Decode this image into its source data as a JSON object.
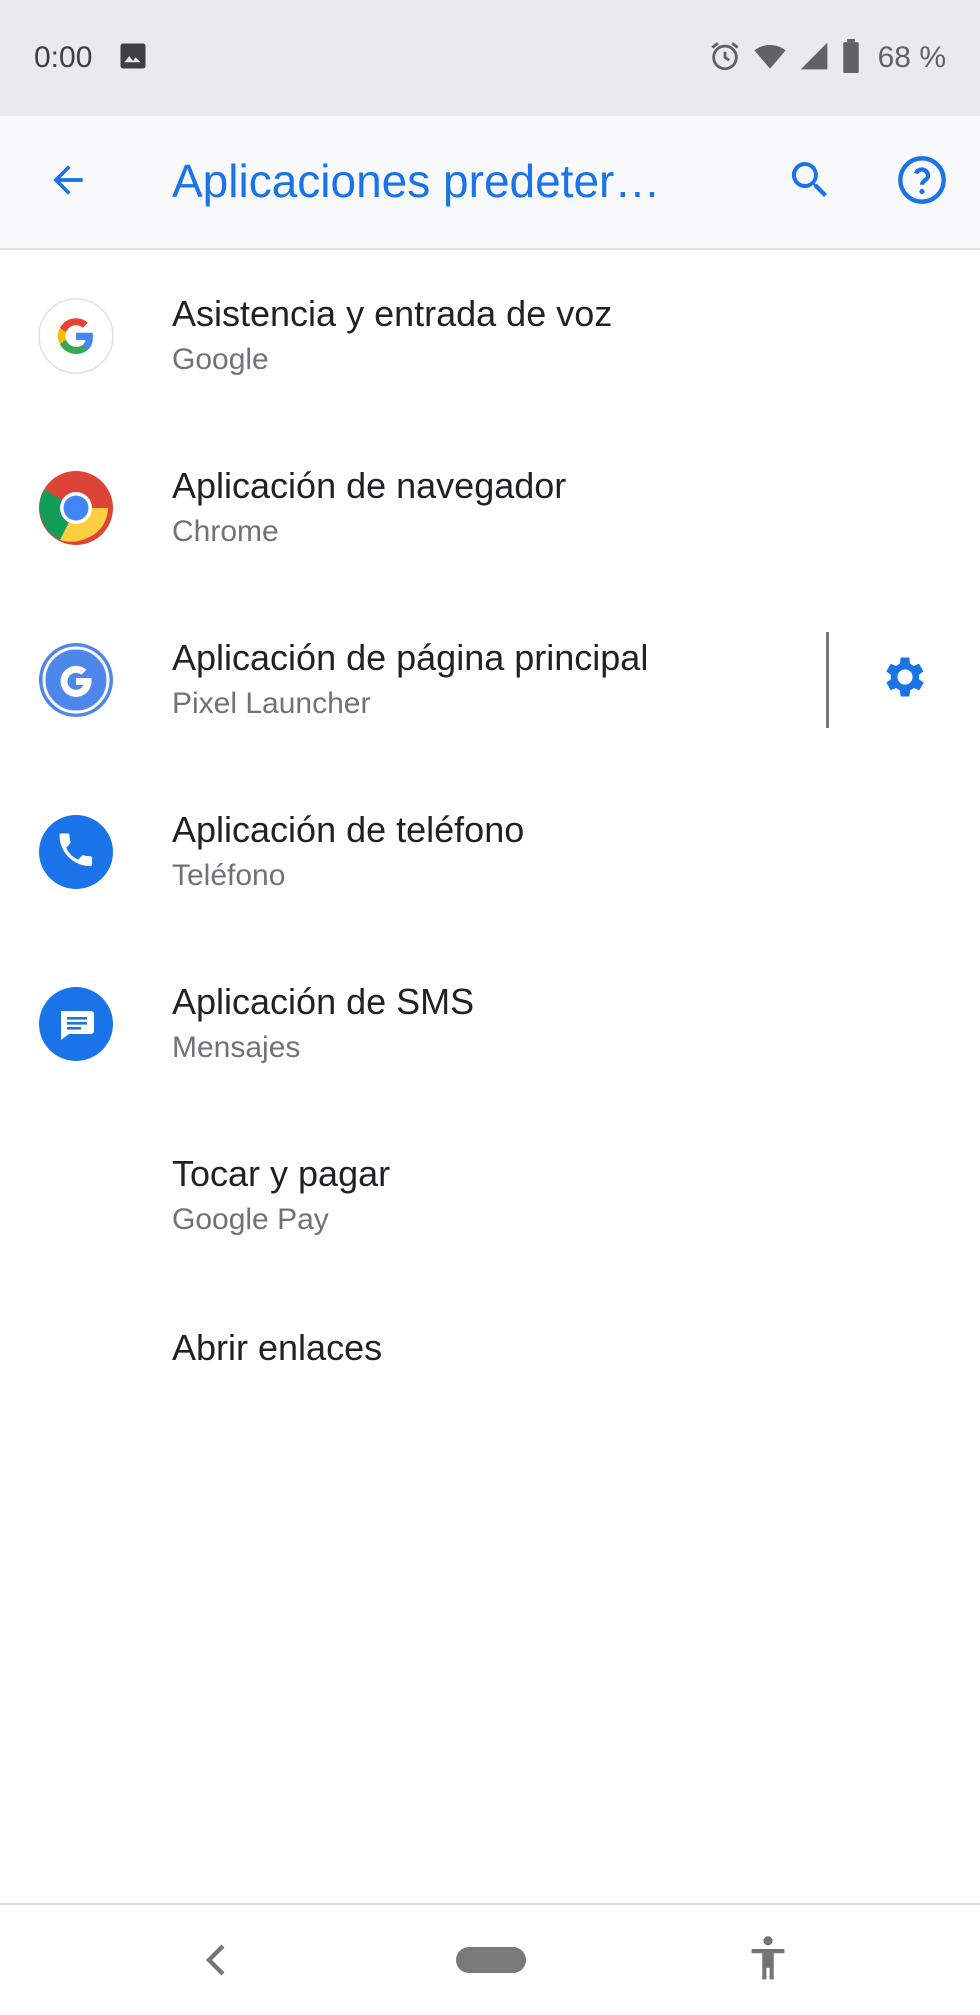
{
  "status_bar": {
    "time": "0:00",
    "battery": "68 %",
    "icons": [
      "image-icon",
      "alarm-icon",
      "wifi-icon",
      "signal-icon",
      "battery-icon"
    ]
  },
  "app_bar": {
    "title": "Aplicaciones predeter…",
    "icons": [
      "back-arrow-icon",
      "search-icon",
      "help-icon"
    ]
  },
  "items": [
    {
      "title": "Asistencia y entrada de voz",
      "subtitle": "Google",
      "icon": "google-icon"
    },
    {
      "title": "Aplicación de navegador",
      "subtitle": "Chrome",
      "icon": "chrome-icon"
    },
    {
      "title": "Aplicación de página principal",
      "subtitle": "Pixel Launcher",
      "icon": "pixel-launcher-icon",
      "action_icon": "gear-icon"
    },
    {
      "title": "Aplicación de teléfono",
      "subtitle": "Teléfono",
      "icon": "phone-icon"
    },
    {
      "title": "Aplicación de SMS",
      "subtitle": "Mensajes",
      "icon": "messages-icon"
    },
    {
      "title": "Tocar y pagar",
      "subtitle": "Google Pay"
    },
    {
      "title": "Abrir enlaces"
    }
  ],
  "nav_bar": {
    "icons": [
      "nav-back-icon",
      "nav-home-pill",
      "accessibility-icon"
    ]
  },
  "colors": {
    "accent": "#1a73e8",
    "status_bar_bg": "#e8eaed",
    "app_bar_bg": "#f8f9fa"
  }
}
